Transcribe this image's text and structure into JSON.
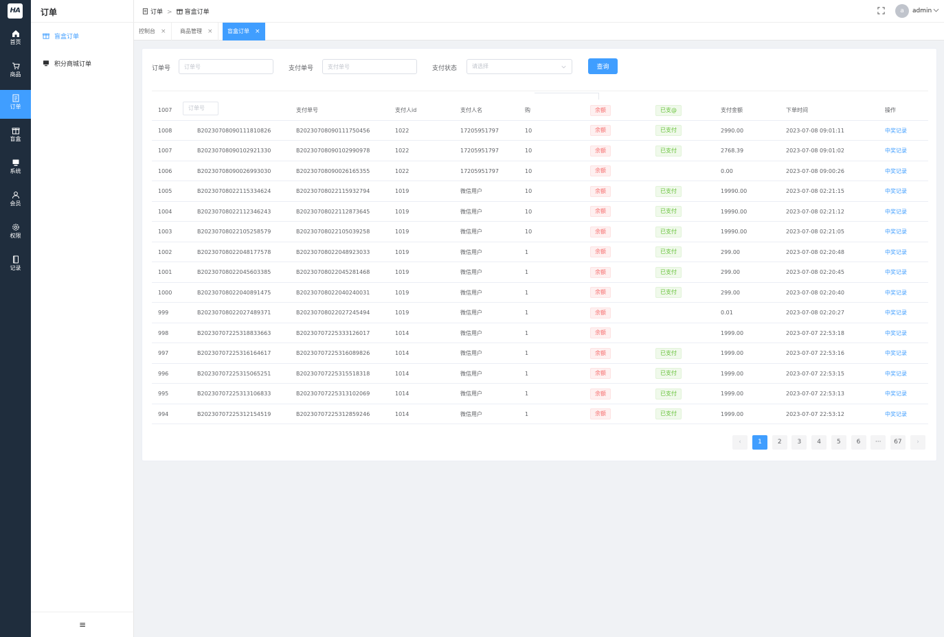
{
  "app": {
    "logo_text": "HA"
  },
  "rail": [
    {
      "label": "首页",
      "icon": "home-icon"
    },
    {
      "label": "商品",
      "icon": "cart-icon"
    },
    {
      "label": "订单",
      "icon": "document-icon"
    },
    {
      "label": "盲盒",
      "icon": "gift-box-icon"
    },
    {
      "label": "系统",
      "icon": "monitor-icon"
    },
    {
      "label": "会员",
      "icon": "user-icon"
    },
    {
      "label": "权限",
      "icon": "gear-icon"
    },
    {
      "label": "记录",
      "icon": "record-icon"
    }
  ],
  "rail_active": "订单",
  "side": {
    "title": "订单",
    "items": [
      {
        "label": "盲盒订单",
        "icon": "gift-box-icon",
        "active": true
      },
      {
        "label": "积分商城订单",
        "icon": "monitor-icon",
        "active": false
      }
    ],
    "collapse_glyph": "≡"
  },
  "header": {
    "breadcrumb": [
      "订单",
      "盲盒订单"
    ],
    "breadcrumb_sep": ">",
    "avatar_letter": "a",
    "username": "admin"
  },
  "tabs": [
    {
      "label": "控制台",
      "close": "×",
      "active": false
    },
    {
      "label": "商品管理",
      "close": "×",
      "active": false
    },
    {
      "label": "盲盒订单",
      "close": "×",
      "active": true
    }
  ],
  "filters": {
    "order_no_label": "订单号",
    "order_no_placeholder": "订单号",
    "pay_no_label": "支付单号",
    "pay_no_placeholder": "支付单号",
    "pay_status_label": "支付状态",
    "pay_status_placeholder": "请选择",
    "query_label": "查询"
  },
  "table": {
    "ghost_placeholder": "订单号",
    "headers": {
      "id": "1007",
      "order_no": "",
      "pay_no": "支付单号",
      "payer_id": "支付人id",
      "payer_name": "支付人名",
      "qty": "购",
      "method": "余额",
      "status": "已支@",
      "amount": "支付金额",
      "time": "下单时间",
      "op": "操作"
    },
    "rows": [
      {
        "id": "1008",
        "order_no": "B20230708090111810826",
        "pay_no": "B20230708090111750456",
        "payer_id": "1022",
        "payer_name": "17205951797",
        "qty": "10",
        "method": "余额",
        "status": "已支付",
        "amount": "2990.00",
        "time": "2023-07-08 09:01:11",
        "op": "中奖记录"
      },
      {
        "id": "1007",
        "order_no": "B20230708090102921330",
        "pay_no": "B20230708090102990978",
        "payer_id": "1022",
        "payer_name": "17205951797",
        "qty": "10",
        "method": "余额",
        "status": "已支付",
        "amount": "2768.39",
        "time": "2023-07-08 09:01:02",
        "op": "中奖记录"
      },
      {
        "id": "1006",
        "order_no": "B20230708090026993030",
        "pay_no": "B20230708090026165355",
        "payer_id": "1022",
        "payer_name": "17205951797",
        "qty": "10",
        "method": "余额",
        "status": "",
        "amount": "0.00",
        "time": "2023-07-08 09:00:26",
        "op": "中奖记录"
      },
      {
        "id": "1005",
        "order_no": "B20230708022115334624",
        "pay_no": "B20230708022115932794",
        "payer_id": "1019",
        "payer_name": "微信用户",
        "qty": "10",
        "method": "余额",
        "status": "已支付",
        "amount": "19990.00",
        "time": "2023-07-08 02:21:15",
        "op": "中奖记录"
      },
      {
        "id": "1004",
        "order_no": "B20230708022112346243",
        "pay_no": "B20230708022112873645",
        "payer_id": "1019",
        "payer_name": "微信用户",
        "qty": "10",
        "method": "余额",
        "status": "已支付",
        "amount": "19990.00",
        "time": "2023-07-08 02:21:12",
        "op": "中奖记录"
      },
      {
        "id": "1003",
        "order_no": "B20230708022105258579",
        "pay_no": "B20230708022105039258",
        "payer_id": "1019",
        "payer_name": "微信用户",
        "qty": "10",
        "method": "余额",
        "status": "已支付",
        "amount": "19990.00",
        "time": "2023-07-08 02:21:05",
        "op": "中奖记录"
      },
      {
        "id": "1002",
        "order_no": "B20230708022048177578",
        "pay_no": "B20230708022048923033",
        "payer_id": "1019",
        "payer_name": "微信用户",
        "qty": "1",
        "method": "余额",
        "status": "已支付",
        "amount": "299.00",
        "time": "2023-07-08 02:20:48",
        "op": "中奖记录"
      },
      {
        "id": "1001",
        "order_no": "B20230708022045603385",
        "pay_no": "B20230708022045281468",
        "payer_id": "1019",
        "payer_name": "微信用户",
        "qty": "1",
        "method": "余额",
        "status": "已支付",
        "amount": "299.00",
        "time": "2023-07-08 02:20:45",
        "op": "中奖记录"
      },
      {
        "id": "1000",
        "order_no": "B20230708022040891475",
        "pay_no": "B20230708022040240031",
        "payer_id": "1019",
        "payer_name": "微信用户",
        "qty": "1",
        "method": "余额",
        "status": "已支付",
        "amount": "299.00",
        "time": "2023-07-08 02:20:40",
        "op": "中奖记录"
      },
      {
        "id": "999",
        "order_no": "B20230708022027489371",
        "pay_no": "B20230708022027245494",
        "payer_id": "1019",
        "payer_name": "微信用户",
        "qty": "1",
        "method": "余额",
        "status": "",
        "amount": "0.01",
        "time": "2023-07-08 02:20:27",
        "op": "中奖记录"
      },
      {
        "id": "998",
        "order_no": "B20230707225318833663",
        "pay_no": "B20230707225333126017",
        "payer_id": "1014",
        "payer_name": "微信用户",
        "qty": "1",
        "method": "余额",
        "status": "",
        "amount": "1999.00",
        "time": "2023-07-07 22:53:18",
        "op": "中奖记录"
      },
      {
        "id": "997",
        "order_no": "B20230707225316164617",
        "pay_no": "B20230707225316089826",
        "payer_id": "1014",
        "payer_name": "微信用户",
        "qty": "1",
        "method": "余额",
        "status": "已支付",
        "amount": "1999.00",
        "time": "2023-07-07 22:53:16",
        "op": "中奖记录"
      },
      {
        "id": "996",
        "order_no": "B20230707225315065251",
        "pay_no": "B20230707225315518318",
        "payer_id": "1014",
        "payer_name": "微信用户",
        "qty": "1",
        "method": "余额",
        "status": "已支付",
        "amount": "1999.00",
        "time": "2023-07-07 22:53:15",
        "op": "中奖记录"
      },
      {
        "id": "995",
        "order_no": "B20230707225313106833",
        "pay_no": "B20230707225313102069",
        "payer_id": "1014",
        "payer_name": "微信用户",
        "qty": "1",
        "method": "余额",
        "status": "已支付",
        "amount": "1999.00",
        "time": "2023-07-07 22:53:13",
        "op": "中奖记录"
      },
      {
        "id": "994",
        "order_no": "B20230707225312154519",
        "pay_no": "B20230707225312859246",
        "payer_id": "1014",
        "payer_name": "微信用户",
        "qty": "1",
        "method": "余额",
        "status": "已支付",
        "amount": "1999.00",
        "time": "2023-07-07 22:53:12",
        "op": "中奖记录"
      }
    ]
  },
  "pagination": {
    "prev": "‹",
    "pages": [
      "1",
      "2",
      "3",
      "4",
      "5",
      "6",
      "···",
      "67"
    ],
    "active": "1",
    "next": "›"
  },
  "colors": {
    "accent": "#409eff",
    "rail_bg": "#1f2d3d",
    "tag_red": "#f56c6c",
    "tag_green": "#67c23a"
  }
}
